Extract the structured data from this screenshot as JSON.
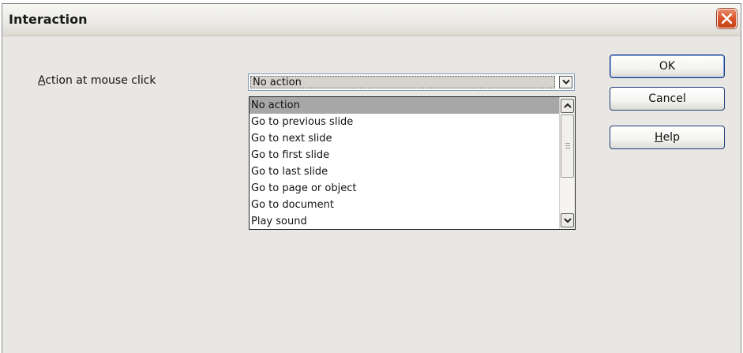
{
  "window": {
    "title": "Interaction",
    "close_icon": "close-icon"
  },
  "form": {
    "action_label": "Action at mouse click",
    "action_mnemonic": "A",
    "action_label_rest": "ction at mouse click",
    "selected_value": "No action",
    "options": [
      "No action",
      "Go to previous slide",
      "Go to next slide",
      "Go to first slide",
      "Go to last slide",
      "Go to page or object",
      "Go to document",
      "Play sound"
    ]
  },
  "buttons": {
    "ok": "OK",
    "cancel": "Cancel",
    "help": "Help",
    "help_mnemonic": "H",
    "help_rest": "elp"
  },
  "colors": {
    "dialog_bg": "#e9e7e3",
    "close_red": "#d9562b",
    "selection_bg": "#a7a7a7",
    "button_border": "#1f3e7a"
  }
}
